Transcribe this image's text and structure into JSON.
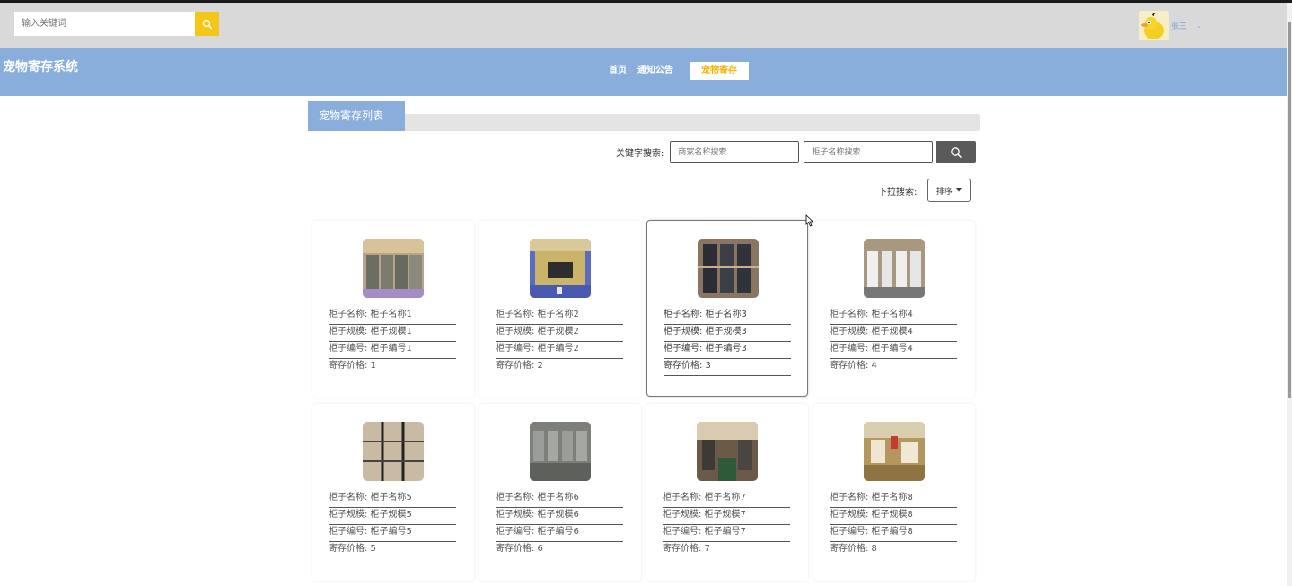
{
  "header": {
    "search_placeholder": "输入关键词",
    "username": "张三",
    "caret": "⌄"
  },
  "nav": {
    "brand": "宠物寄存系统",
    "items": [
      {
        "label": "首页"
      },
      {
        "label": "通知公告"
      },
      {
        "label": "宠物寄存"
      }
    ],
    "active_index": 2
  },
  "panel": {
    "title": "宠物寄存列表",
    "keyword_label": "关键字搜索:",
    "keyword_placeholder_1": "商家名称搜索",
    "keyword_placeholder_2": "柜子名称搜索",
    "dropdown_label": "下拉搜索:",
    "dropdown_value": "排序"
  },
  "cards": [
    {
      "name": "柜子名称: 柜子名称1",
      "spec": "柜子规模: 柜子规模1",
      "code": "柜子编号: 柜子编号1",
      "price": "寄存价格: 1"
    },
    {
      "name": "柜子名称: 柜子名称2",
      "spec": "柜子规模: 柜子规模2",
      "code": "柜子编号: 柜子编号2",
      "price": "寄存价格: 2"
    },
    {
      "name": "柜子名称: 柜子名称3",
      "spec": "柜子规模: 柜子规模3",
      "code": "柜子编号: 柜子编号3",
      "price": "寄存价格: 3"
    },
    {
      "name": "柜子名称: 柜子名称4",
      "spec": "柜子规模: 柜子规模4",
      "code": "柜子编号: 柜子编号4",
      "price": "寄存价格: 4"
    },
    {
      "name": "柜子名称: 柜子名称5",
      "spec": "柜子规模: 柜子规模5",
      "code": "柜子编号: 柜子编号5",
      "price": "寄存价格: 5"
    },
    {
      "name": "柜子名称: 柜子名称6",
      "spec": "柜子规模: 柜子规模6",
      "code": "柜子编号: 柜子编号6",
      "price": "寄存价格: 6"
    },
    {
      "name": "柜子名称: 柜子名称7",
      "spec": "柜子规模: 柜子规模7",
      "code": "柜子编号: 柜子编号7",
      "price": "寄存价格: 7"
    },
    {
      "name": "柜子名称: 柜子名称8",
      "spec": "柜子规模: 柜子规模8",
      "code": "柜子编号: 柜子编号8",
      "price": "寄存价格: 8"
    }
  ],
  "colors": {
    "accent_yellow": "#f5c518",
    "nav_blue": "#8aaedc",
    "topbar_gray": "#d9d9d9"
  }
}
